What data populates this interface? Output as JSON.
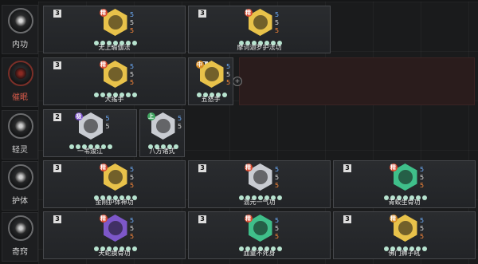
{
  "categories": [
    {
      "label": "内功"
    },
    {
      "label": "催眠"
    },
    {
      "label": "轻灵"
    },
    {
      "label": "护体"
    },
    {
      "label": "奇窍"
    }
  ],
  "colors": {
    "gold": "#e8c24a",
    "purple": "#7d57c9",
    "green": "#3fbf8a",
    "silver": "#c9ccd2",
    "tag_red": "#d84a2f",
    "tag_green": "#3ea35e",
    "tag_purple": "#7a4fc9",
    "tag_orange": "#d68a22"
  },
  "cards": [
    {
      "row": 0,
      "name": "无上瑜伽法",
      "level": "3",
      "tag": "精",
      "tag_color": "tag_red",
      "hex_color": "gold",
      "nums": [
        "5",
        "5",
        "5"
      ],
      "dots_on": 7,
      "dots_total": 7
    },
    {
      "row": 0,
      "name": "摩诃迦罗护法功",
      "level": "3",
      "tag": "精",
      "tag_color": "tag_red",
      "hex_color": "gold",
      "nums": [
        "5",
        "5",
        "5"
      ],
      "dots_on": 7,
      "dots_total": 7
    },
    {
      "row": 1,
      "name": "大搖手",
      "level": "3",
      "tag": "精",
      "tag_color": "tag_red",
      "hex_color": "gold",
      "nums": [
        "5",
        "5",
        "5"
      ],
      "dots_on": 7,
      "dots_total": 7
    },
    {
      "row": 1,
      "name": "五怒手",
      "level": "1",
      "tag": "中",
      "tag_color": "tag_orange",
      "hex_color": "gold",
      "nums": [
        "5",
        "5",
        "5"
      ],
      "dots_on": 5,
      "dots_total": 5
    },
    {
      "row": 2,
      "name": "一苇渡江",
      "level": "2",
      "tag": "极",
      "tag_color": "tag_purple",
      "hex_color": "silver",
      "nums": [
        "5",
        "5",
        ""
      ],
      "dots_on": 7,
      "dots_total": 7
    },
    {
      "row": 2,
      "name": "八方诸式",
      "level": "",
      "tag": "上",
      "tag_color": "tag_green",
      "hex_color": "silver",
      "nums": [
        "5",
        "5",
        ""
      ],
      "dots_on": 5,
      "dots_total": 5
    },
    {
      "row": 3,
      "name": "金刚护体神功",
      "level": "3",
      "tag": "精",
      "tag_color": "tag_red",
      "hex_color": "gold",
      "nums": [
        "5",
        "5",
        "5"
      ],
      "dots_on": 7,
      "dots_total": 7
    },
    {
      "row": 3,
      "name": "混元一气功",
      "level": "3",
      "tag": "精",
      "tag_color": "tag_red",
      "hex_color": "silver",
      "nums": [
        "5",
        "5",
        "5"
      ],
      "dots_on": 7,
      "dots_total": 7
    },
    {
      "row": 3,
      "name": "青蛟生骨功",
      "level": "3",
      "tag": "精",
      "tag_color": "tag_red",
      "hex_color": "green",
      "nums": [
        "5",
        "5",
        "5"
      ],
      "dots_on": 7,
      "dots_total": 7
    },
    {
      "row": 4,
      "name": "夭蛇换骨功",
      "level": "3",
      "tag": "精",
      "tag_color": "tag_red",
      "hex_color": "purple",
      "nums": [
        "5",
        "5",
        "5"
      ],
      "dots_on": 7,
      "dots_total": 7
    },
    {
      "row": 4,
      "name": "血童不死身",
      "level": "3",
      "tag": "精",
      "tag_color": "tag_red",
      "hex_color": "green",
      "nums": [
        "5",
        "5",
        "5"
      ],
      "dots_on": 7,
      "dots_total": 7
    },
    {
      "row": 4,
      "name": "佛门狮子吼",
      "level": "3",
      "tag": "精",
      "tag_color": "tag_orange",
      "hex_color": "gold",
      "nums": [
        "5",
        "5",
        "5"
      ],
      "dots_on": 7,
      "dots_total": 7
    }
  ]
}
